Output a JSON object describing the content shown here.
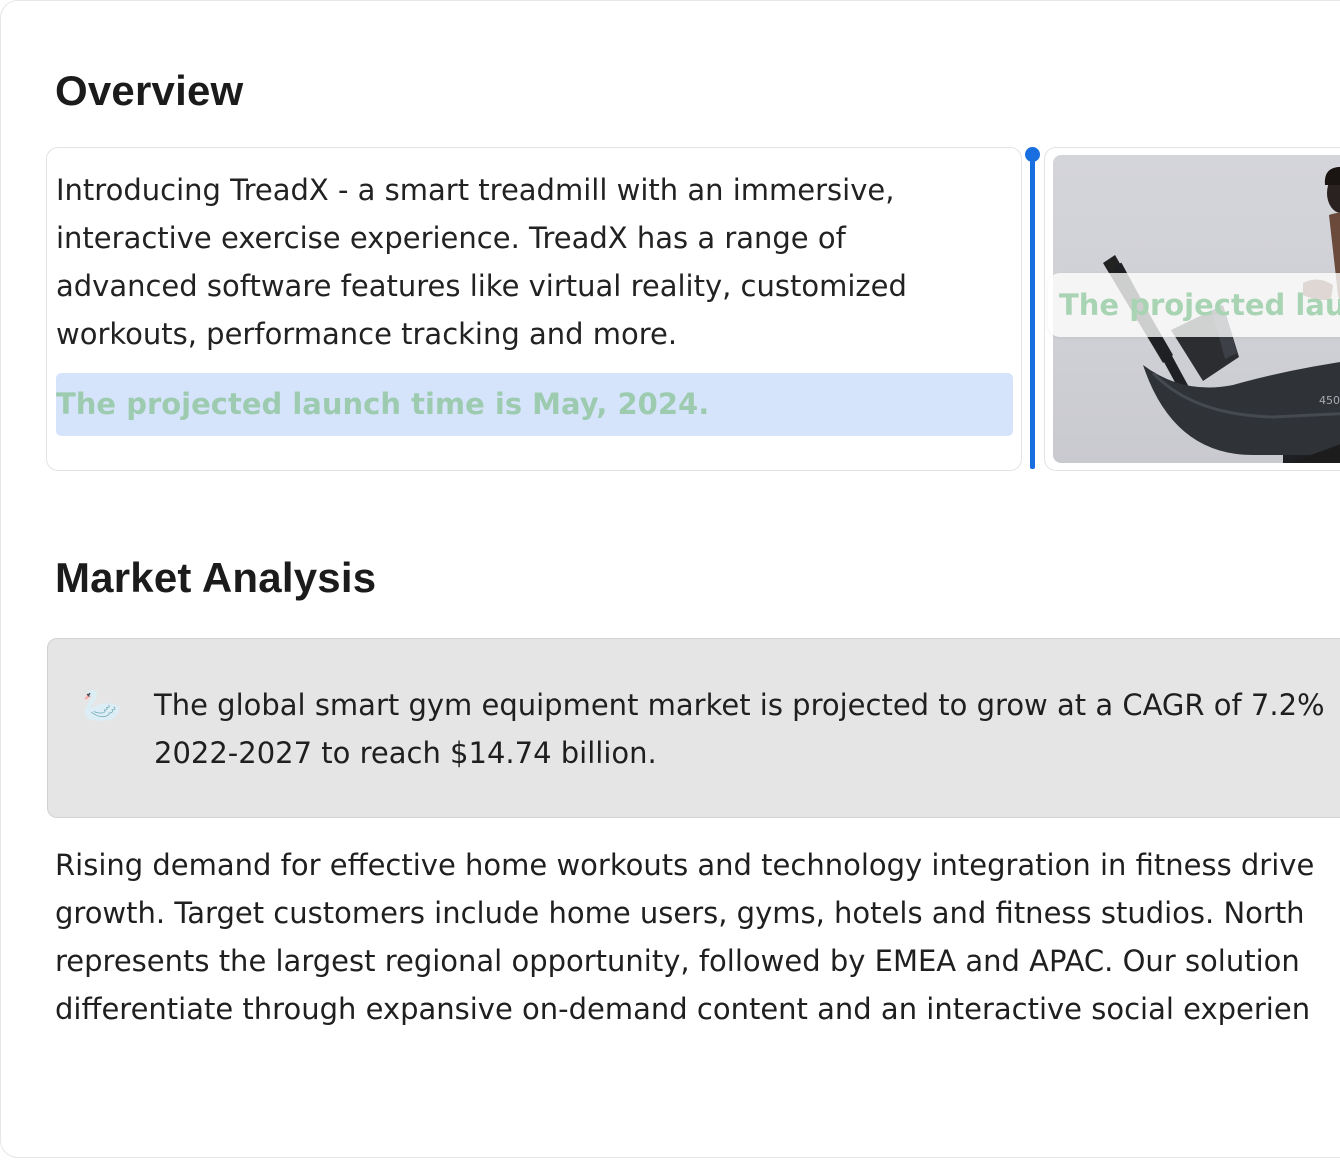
{
  "overview": {
    "heading": "Overview",
    "paragraph_lines": [
      "Introducing TreadX - a smart treadmill with an immersive,",
      "interactive exercise experience. TreadX has a range of",
      "advanced software features like virtual reality, customized",
      "workouts, performance tracking and more."
    ],
    "launch_text": "The projected launch time is May, 2024.",
    "drag_ghost_text": "The projected laun",
    "image": {
      "description_icon": "treadmill-photo",
      "console_label": "450"
    }
  },
  "market_analysis": {
    "heading": "Market Analysis",
    "callout": {
      "icon": "swan-emoji",
      "icon_glyph": "🦢",
      "lines": [
        "The global smart gym equipment market is projected to grow at a CAGR of 7.2%",
        "2022-2027 to reach $14.74 billion."
      ]
    },
    "paragraph_lines": [
      "Rising demand for effective home workouts and technology integration in fitness drive",
      "growth. Target customers include home users, gyms, hotels and fitness studios. North",
      "represents the largest regional opportunity, followed by EMEA and APAC. Our solution",
      "differentiate through expansive on-demand content and an interactive social experien"
    ]
  },
  "colors": {
    "drop_indicator": "#1a6fe0",
    "selection_bg": "#d6e4fb",
    "launch_text": "#9dcbb0",
    "callout_bg": "#e5e5e5"
  }
}
